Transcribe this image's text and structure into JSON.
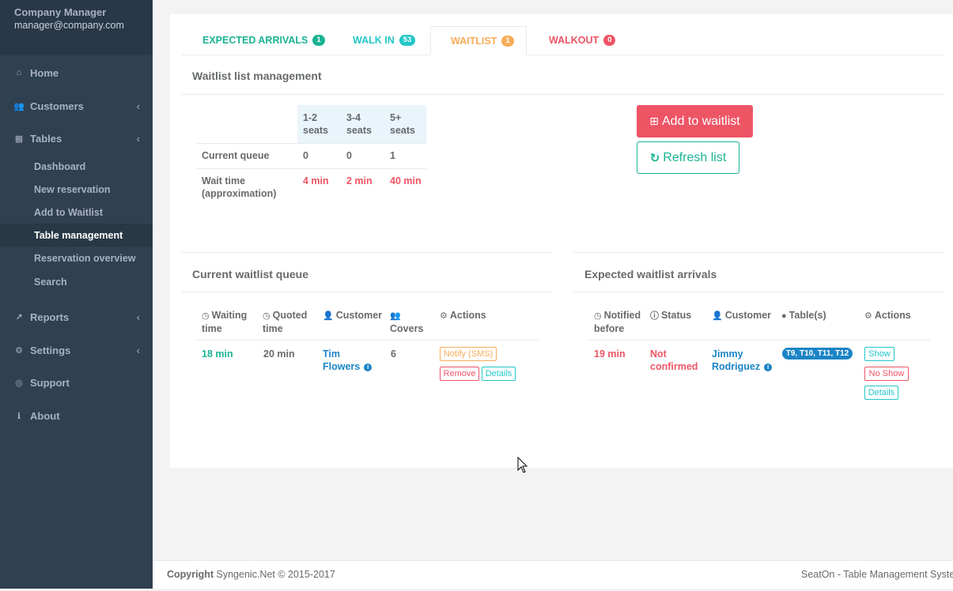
{
  "sidebar": {
    "profile": {
      "name": "Company Manager",
      "email": "manager@company.com"
    },
    "items": [
      {
        "label": "Home",
        "icon": "home-icon",
        "glyph": "⌂"
      },
      {
        "label": "Customers",
        "icon": "users-icon",
        "glyph": "👥",
        "chevron": "‹"
      },
      {
        "label": "Tables",
        "icon": "calendar-icon",
        "glyph": "▦",
        "chevron": "‹"
      },
      {
        "label": "Reports",
        "icon": "chart-icon",
        "glyph": "↗",
        "chevron": "‹"
      },
      {
        "label": "Settings",
        "icon": "gears-icon",
        "glyph": "⚙",
        "chevron": "‹"
      },
      {
        "label": "Support",
        "icon": "lifebuoy-icon",
        "glyph": "◎"
      },
      {
        "label": "About",
        "icon": "info-icon",
        "glyph": "ℹ"
      }
    ],
    "tables_sub": [
      "Dashboard",
      "New reservation",
      "Add to Waitlist",
      "Table management",
      "Reservation overview",
      "Search"
    ]
  },
  "tabs": [
    {
      "label": "EXPECTED ARRIVALS",
      "count": "1",
      "color": "#1ab394"
    },
    {
      "label": "WALK IN",
      "count": "53",
      "color": "#23c6c8"
    },
    {
      "label": "WAITLIST",
      "count": "1",
      "color": "#f8ac59"
    },
    {
      "label": "WALKOUT",
      "count": "0",
      "color": "#ed5565"
    }
  ],
  "management": {
    "title": "Waitlist list management",
    "headers": [
      "1-2\nseats",
      "3-4\nseats",
      "5+\nseats"
    ],
    "rows": [
      {
        "label": "Current queue",
        "values": [
          "0",
          "0",
          "1"
        ]
      },
      {
        "label": "Wait time\n(approximation)",
        "values": [
          "4 min",
          "2 min",
          "40 min"
        ]
      }
    ],
    "add_button": "Add to waitlist",
    "refresh_button": "Refresh list"
  },
  "queue": {
    "title": "Current waitlist queue",
    "headers": [
      "Waiting\ntime",
      "Quoted\ntime",
      "Customer",
      "Covers",
      "Actions"
    ],
    "row": {
      "waiting": "18 min",
      "quoted": "20 min",
      "customer": "Tim\nFlowers",
      "covers": "6"
    },
    "actions": {
      "notify": "Notify (SMS)",
      "remove": "Remove",
      "details": "Details"
    }
  },
  "arrivals": {
    "title": "Expected waitlist arrivals",
    "headers": [
      "Notified\nbefore",
      "Status",
      "Customer",
      "Table(s)",
      "Actions"
    ],
    "row": {
      "notified": "19 min",
      "status": "Not\nconfirmed",
      "customer": "Jimmy\nRodriguez",
      "tables": "T9, T10, T11, T12"
    },
    "actions": {
      "show": "Show",
      "noshow": "No Show",
      "details": "Details"
    }
  },
  "footer": {
    "copyright_label": "Copyright",
    "copyright_text": "Syngenic.Net © 2015-2017",
    "right": "SeatOn - Table Management System"
  },
  "colors": {
    "sidebar": "#2f4050",
    "primary": "#1ab394",
    "danger": "#ed5565",
    "warning": "#f8ac59",
    "info": "#23c6c8",
    "success": "#1c84c6"
  }
}
